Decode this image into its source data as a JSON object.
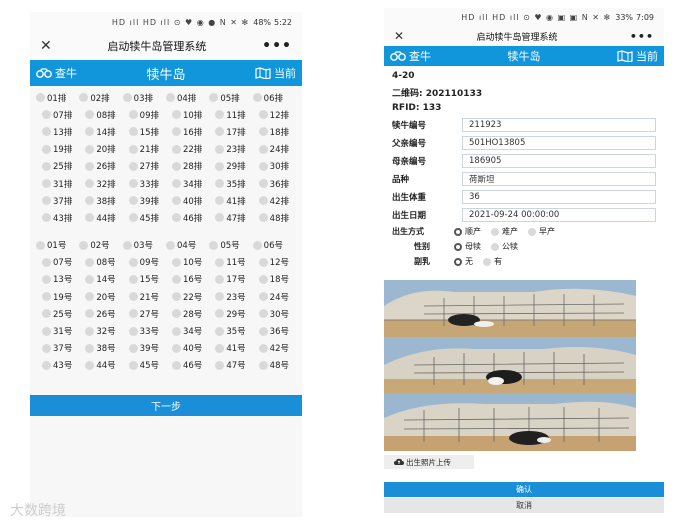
{
  "left": {
    "status": {
      "icons": "HD ıll HD ıll ⊙ ♥ ◉ ● N ✕ ✻",
      "battery": "48%",
      "time": "5:22"
    },
    "titlebar": {
      "title": "启动犊牛岛管理系统",
      "more": "•••"
    },
    "navbar": {
      "left": "查牛",
      "center": "犊牛岛",
      "right": "当前"
    },
    "rows_grid": [
      "01排",
      "02排",
      "03排",
      "04排",
      "05排",
      "06排",
      "07排",
      "08排",
      "09排",
      "10排",
      "11排",
      "12排",
      "13排",
      "14排",
      "15排",
      "16排",
      "17排",
      "18排",
      "19排",
      "20排",
      "21排",
      "22排",
      "23排",
      "24排",
      "25排",
      "26排",
      "27排",
      "28排",
      "29排",
      "30排",
      "31排",
      "32排",
      "33排",
      "34排",
      "35排",
      "36排",
      "37排",
      "38排",
      "39排",
      "40排",
      "41排",
      "42排",
      "43排",
      "44排",
      "45排",
      "46排",
      "47排",
      "48排"
    ],
    "nums_grid": [
      "01号",
      "02号",
      "03号",
      "04号",
      "05号",
      "06号",
      "07号",
      "08号",
      "09号",
      "10号",
      "11号",
      "12号",
      "13号",
      "14号",
      "15号",
      "16号",
      "17号",
      "18号",
      "19号",
      "20号",
      "21号",
      "22号",
      "23号",
      "24号",
      "25号",
      "26号",
      "27号",
      "28号",
      "29号",
      "30号",
      "31号",
      "32号",
      "33号",
      "34号",
      "35号",
      "36号",
      "37号",
      "38号",
      "39号",
      "40号",
      "41号",
      "42号",
      "43号",
      "44号",
      "45号",
      "46号",
      "47号",
      "48号"
    ],
    "next_button": "下一步"
  },
  "right": {
    "status": {
      "icons": "HD ıll HD ıll ⊙ ♥ ◉ ▣ ▣ N ✕ ✻",
      "battery": "33%",
      "time": "7:09"
    },
    "titlebar": {
      "title": "启动犊牛岛管理系统",
      "more": "•••"
    },
    "navbar": {
      "left": "查牛",
      "center": "犊牛岛",
      "right": "当前"
    },
    "position": "4-20",
    "qrcode": "二维码: 202110133",
    "rfid": "RFID: 133",
    "fields": [
      {
        "label": "犊牛编号",
        "value": "211923"
      },
      {
        "label": "父亲编号",
        "value": "501HO13805"
      },
      {
        "label": "母亲编号",
        "value": "186905"
      },
      {
        "label": "品种",
        "value": "荷斯坦"
      },
      {
        "label": "出生体重",
        "value": "36"
      },
      {
        "label": "出生日期",
        "value": "2021-09-24 00:00:00"
      }
    ],
    "birth_method": {
      "label": "出生方式",
      "options": [
        "顺产",
        "难产",
        "早产"
      ],
      "selected": "顺产"
    },
    "gender": {
      "label": "性别",
      "options": [
        "母犊",
        "公犊"
      ],
      "selected": "母犊"
    },
    "side_milk": {
      "label": "副乳",
      "options": [
        "无",
        "有"
      ],
      "selected": "无"
    },
    "upload_button": "出生照片上传",
    "confirm_button": "确认",
    "cancel_button": "取消"
  },
  "colors": {
    "accent": "#1296db",
    "button": "#1a8fd8"
  },
  "watermark": "大数跨境"
}
